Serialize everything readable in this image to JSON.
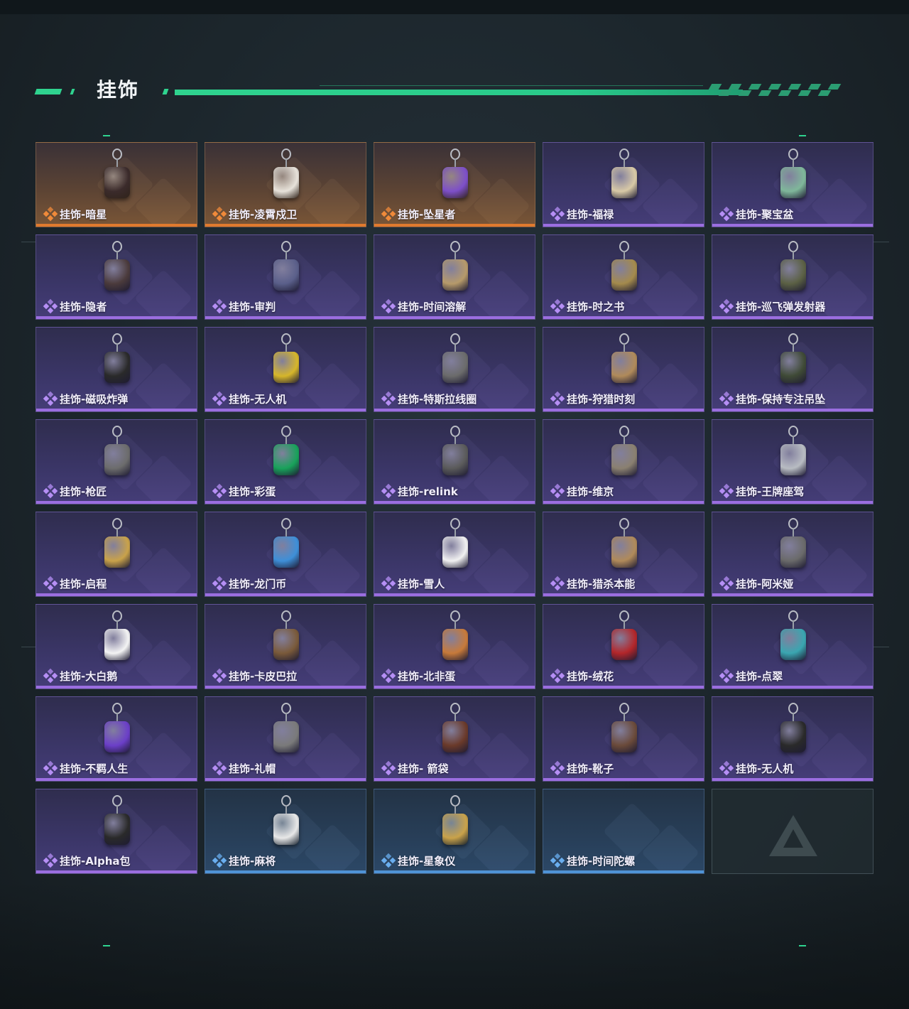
{
  "section": {
    "title": "挂饰"
  },
  "items": [
    {
      "label": "挂饰-暗星",
      "rarity": "gold",
      "color": "#3b2b2b",
      "icon": "crane-charm"
    },
    {
      "label": "挂饰-凌霄戍卫",
      "rarity": "gold",
      "color": "#e7e2da",
      "icon": "eagle-charm"
    },
    {
      "label": "挂饰-坠星者",
      "rarity": "gold",
      "color": "#7d4fc8",
      "icon": "crystal-charm"
    },
    {
      "label": "挂饰-福禄",
      "rarity": "purple",
      "color": "#d8c9a6",
      "icon": "gourd-charm"
    },
    {
      "label": "挂饰-聚宝盆",
      "rarity": "purple",
      "color": "#7fb79a",
      "icon": "treasure-bowl-charm"
    },
    {
      "label": "挂饰-隐者",
      "rarity": "purple",
      "color": "#4b3b3c",
      "icon": "tarot-card-charm"
    },
    {
      "label": "挂饰-审判",
      "rarity": "purple",
      "color": "#5a5f8a",
      "icon": "tarot-card-charm"
    },
    {
      "label": "挂饰-时间溶解",
      "rarity": "purple",
      "color": "#b69a6a",
      "icon": "melting-clock-charm"
    },
    {
      "label": "挂饰-时之书",
      "rarity": "purple",
      "color": "#a48a4c",
      "icon": "book-charm"
    },
    {
      "label": "挂饰-巡飞弹发射器",
      "rarity": "purple",
      "color": "#5b6044",
      "icon": "launcher-charm"
    },
    {
      "label": "挂饰-磁吸炸弹",
      "rarity": "purple",
      "color": "#2a2a2a",
      "icon": "bomb-charm"
    },
    {
      "label": "挂饰-无人机",
      "rarity": "purple",
      "color": "#d6b62a",
      "icon": "drone-charm"
    },
    {
      "label": "挂饰-特斯拉线圈",
      "rarity": "purple",
      "color": "#6b6b6b",
      "icon": "tesla-coil-charm"
    },
    {
      "label": "挂饰-狩猎时刻",
      "rarity": "purple",
      "color": "#b08a5a",
      "icon": "antlers-charm"
    },
    {
      "label": "挂饰-保持专注吊坠",
      "rarity": "purple",
      "color": "#3f4a36",
      "icon": "tag-charm"
    },
    {
      "label": "挂饰-枪匠",
      "rarity": "purple",
      "color": "#6c6c6c",
      "icon": "box-charm"
    },
    {
      "label": "挂饰-彩蛋",
      "rarity": "purple",
      "color": "#18a25a",
      "icon": "egg-charm"
    },
    {
      "label": "挂饰-relink",
      "rarity": "purple",
      "color": "#5a5a5a",
      "icon": "emblem-charm"
    },
    {
      "label": "挂饰-维京",
      "rarity": "purple",
      "color": "#8a8070",
      "icon": "hammer-charm"
    },
    {
      "label": "挂饰-王牌座驾",
      "rarity": "purple",
      "color": "#b8bcc2",
      "icon": "jet-charm"
    },
    {
      "label": "挂饰-启程",
      "rarity": "purple",
      "color": "#c9a24a",
      "icon": "compass-ring-charm"
    },
    {
      "label": "挂饰-龙门币",
      "rarity": "purple",
      "color": "#3e8fd8",
      "icon": "coin-card-charm"
    },
    {
      "label": "挂饰-雪人",
      "rarity": "purple",
      "color": "#f1f1f1",
      "icon": "snowman-charm"
    },
    {
      "label": "挂饰-猎杀本能",
      "rarity": "purple",
      "color": "#b08a5a",
      "icon": "antlers-charm"
    },
    {
      "label": "挂饰-阿米娅",
      "rarity": "purple",
      "color": "#6a6a6a",
      "icon": "rabbit-charm"
    },
    {
      "label": "挂饰-大白鹅",
      "rarity": "purple",
      "color": "#f4f4f4",
      "icon": "goose-charm"
    },
    {
      "label": "挂饰-卡皮巴拉",
      "rarity": "purple",
      "color": "#7a5a3a",
      "icon": "capybara-charm"
    },
    {
      "label": "挂饰-北非蛋",
      "rarity": "purple",
      "color": "#c77a3a",
      "icon": "shakshuka-charm"
    },
    {
      "label": "挂饰-绒花",
      "rarity": "purple",
      "color": "#b3262a",
      "icon": "flower-charm"
    },
    {
      "label": "挂饰-点翠",
      "rarity": "purple",
      "color": "#3aa6b0",
      "icon": "phoenix-charm"
    },
    {
      "label": "挂饰-不羁人生",
      "rarity": "purple",
      "color": "#6b3fc8",
      "icon": "sneaker-charm"
    },
    {
      "label": "挂饰-礼帽",
      "rarity": "purple",
      "color": "#7a7a7a",
      "icon": "hat-charm"
    },
    {
      "label": "挂饰- 箭袋",
      "rarity": "purple",
      "color": "#6a3a2a",
      "icon": "quiver-charm"
    },
    {
      "label": "挂饰-靴子",
      "rarity": "purple",
      "color": "#6a4a3a",
      "icon": "boot-charm"
    },
    {
      "label": "挂饰-无人机",
      "rarity": "purple",
      "color": "#2a2a2a",
      "icon": "wheel-drone-charm"
    },
    {
      "label": "挂饰-Alpha包",
      "rarity": "purple",
      "color": "#2a2a2a",
      "icon": "pouch-charm"
    },
    {
      "label": "挂饰-麻将",
      "rarity": "blue",
      "color": "#e8e8e8",
      "icon": "mahjong-tile-charm"
    },
    {
      "label": "挂饰-星象仪",
      "rarity": "blue",
      "color": "#c9a24a",
      "icon": "astrolabe-charm"
    },
    {
      "label": "挂饰-时间陀螺",
      "rarity": "blue",
      "color": "",
      "icon": ""
    },
    {
      "label": "",
      "rarity": "empty",
      "color": "",
      "icon": "delta-logo-icon"
    }
  ],
  "colors": {
    "accent": "#2fd38f",
    "gold": "#e07a2e",
    "purple": "#9b6ee0",
    "blue": "#4f93d6"
  }
}
